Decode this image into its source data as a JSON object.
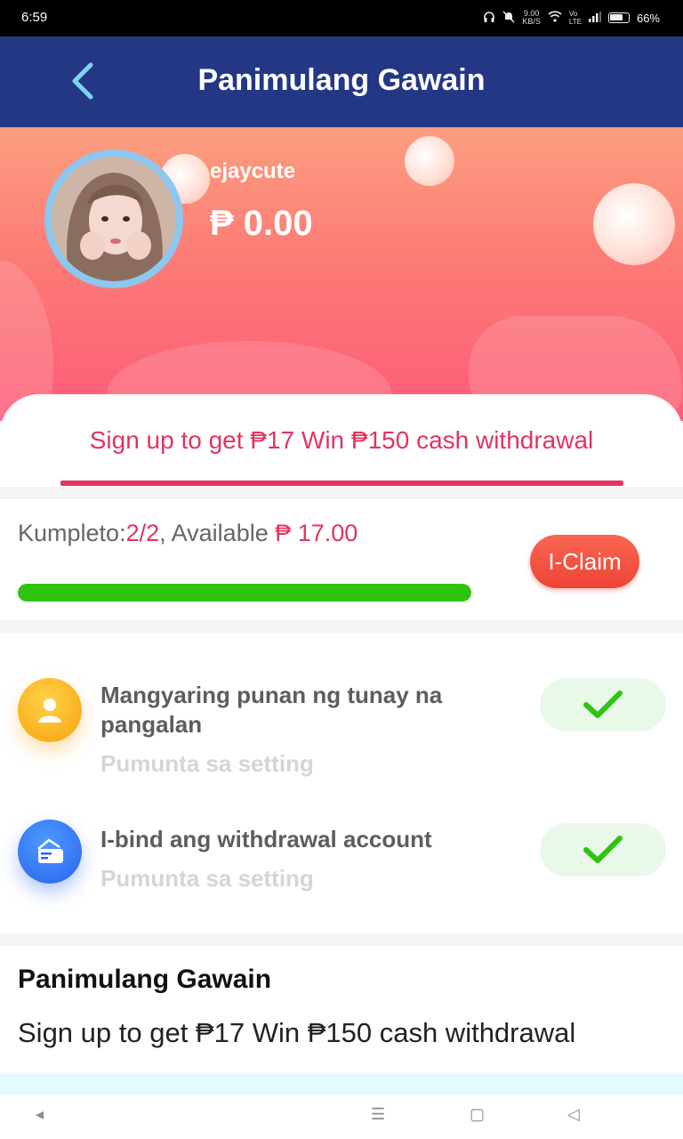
{
  "status_bar": {
    "time": "6:59",
    "speed": "9.00",
    "speed_unit": "KB/S",
    "battery": "66%"
  },
  "header": {
    "title": "Panimulang Gawain"
  },
  "profile": {
    "username": "ejaycute",
    "balance": "₱ 0.00"
  },
  "tab": {
    "label": "Sign up to get ₱17 Win ₱150 cash withdrawal"
  },
  "progress": {
    "prefix": "Kumpleto:",
    "count": "2/2",
    "middle": ", Available ",
    "amount": "₱ 17.00",
    "fraction": 1.0,
    "claim_label": "I-Claim"
  },
  "tasks": [
    {
      "title": "Mangyaring punan ng tunay na pangalan",
      "subtitle": "Pumunta sa setting",
      "icon": "person-icon",
      "done": true
    },
    {
      "title": "I-bind ang withdrawal account",
      "subtitle": "Pumunta sa setting",
      "icon": "card-icon",
      "done": true
    }
  ],
  "description": {
    "title": "Panimulang Gawain",
    "body": "Sign up to get ₱17 Win ₱150 cash withdrawal"
  },
  "colors": {
    "header_bg": "#233785",
    "accent": "#e0355f",
    "progress_fill": "#2ec40f",
    "claim_button": "#f04a3a"
  }
}
